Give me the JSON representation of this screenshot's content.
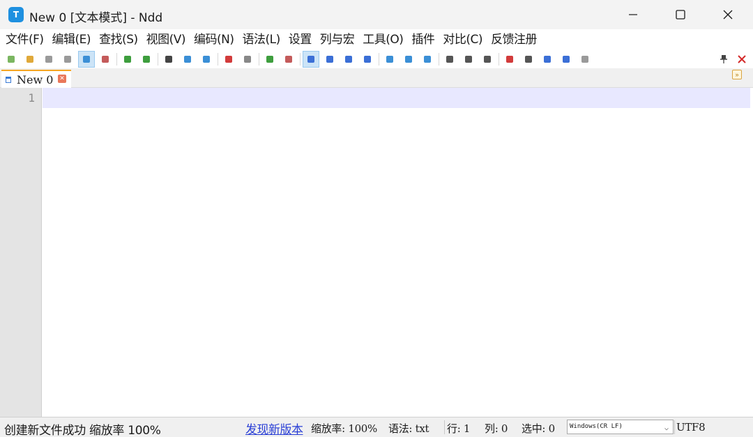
{
  "window": {
    "title": "New 0 [文本模式] - Ndd",
    "app_icon_letter": "T"
  },
  "menu": [
    {
      "label": "文件(F)",
      "name": "menu-file"
    },
    {
      "label": "编辑(E)",
      "name": "menu-edit"
    },
    {
      "label": "查找(S)",
      "name": "menu-search"
    },
    {
      "label": "视图(V)",
      "name": "menu-view"
    },
    {
      "label": "编码(N)",
      "name": "menu-encoding"
    },
    {
      "label": "语法(L)",
      "name": "menu-syntax"
    },
    {
      "label": "设置",
      "name": "menu-settings"
    },
    {
      "label": "列与宏",
      "name": "menu-column-macro"
    },
    {
      "label": "工具(O)",
      "name": "menu-tools"
    },
    {
      "label": "插件",
      "name": "menu-plugins"
    },
    {
      "label": "对比(C)",
      "name": "menu-compare"
    },
    {
      "label": "反馈注册",
      "name": "menu-feedback-register"
    }
  ],
  "toolbar": {
    "buttons": [
      {
        "name": "new-file-icon",
        "color": "#7bb661"
      },
      {
        "name": "open-file-icon",
        "color": "#e0a93a"
      },
      {
        "name": "save-icon",
        "color": "#9a9a9a"
      },
      {
        "name": "save-all-icon",
        "color": "#9a9a9a"
      },
      {
        "name": "auto-save-icon",
        "color": "#3b8fd6",
        "active": true
      },
      {
        "name": "close-file-icon",
        "color": "#c45b5b"
      },
      {
        "name": "undo-icon",
        "color": "#3e9e3e"
      },
      {
        "name": "redo-icon",
        "color": "#3e9e3e"
      },
      {
        "name": "find-icon",
        "color": "#444444"
      },
      {
        "name": "replace-icon",
        "color": "#3b8fd6"
      },
      {
        "name": "find-in-files-icon",
        "color": "#3b8fd6"
      },
      {
        "name": "mark-icon",
        "color": "#d23b3b"
      },
      {
        "name": "clear-mark-icon",
        "color": "#888888"
      },
      {
        "name": "zoom-in-icon",
        "color": "#3e9e3e"
      },
      {
        "name": "zoom-out-icon",
        "color": "#c45b5b"
      },
      {
        "name": "word-wrap-icon",
        "color": "#3b6fd6",
        "active": true
      },
      {
        "name": "show-symbols-icon",
        "color": "#3b6fd6"
      },
      {
        "name": "indent-guide-icon",
        "color": "#3b6fd6"
      },
      {
        "name": "show-whitespace-icon",
        "color": "#3b6fd6"
      },
      {
        "name": "fold-back-icon",
        "color": "#3b8fd6"
      },
      {
        "name": "fold-forward-icon",
        "color": "#3b8fd6"
      },
      {
        "name": "link-icon",
        "color": "#3b8fd6"
      },
      {
        "name": "compare-dir-icon",
        "color": "#555555"
      },
      {
        "name": "compare-file-icon",
        "color": "#555555"
      },
      {
        "name": "monitor-icon",
        "color": "#555555"
      },
      {
        "name": "record-macro-icon",
        "color": "#d23b3b"
      },
      {
        "name": "stop-macro-icon",
        "color": "#555555"
      },
      {
        "name": "play-macro-icon",
        "color": "#3b6fd6"
      },
      {
        "name": "run-macro-multiple-icon",
        "color": "#3b6fd6"
      },
      {
        "name": "save-macro-icon",
        "color": "#9a9a9a"
      }
    ],
    "pin_icon": "pin-icon",
    "close_icon": "close-doc-icon"
  },
  "tabs": [
    {
      "label": "New 0",
      "active": true
    }
  ],
  "editor": {
    "line_numbers": [
      "1"
    ],
    "current_line_color": "#e8e8ff"
  },
  "status": {
    "message": "创建新文件成功 缩放率 100%",
    "update_link": "发现新版本",
    "zoom": "缩放率: 100%",
    "syntax": "语法: txt",
    "line": "行: 1",
    "column": "列: 0",
    "selection": "选中: 0",
    "eol": "Windows(CR LF)",
    "encoding": "UTF8"
  },
  "colors": {
    "accent": "#1e90e0",
    "tab_highlight": "#f5a623",
    "link": "#2a3fd6"
  }
}
